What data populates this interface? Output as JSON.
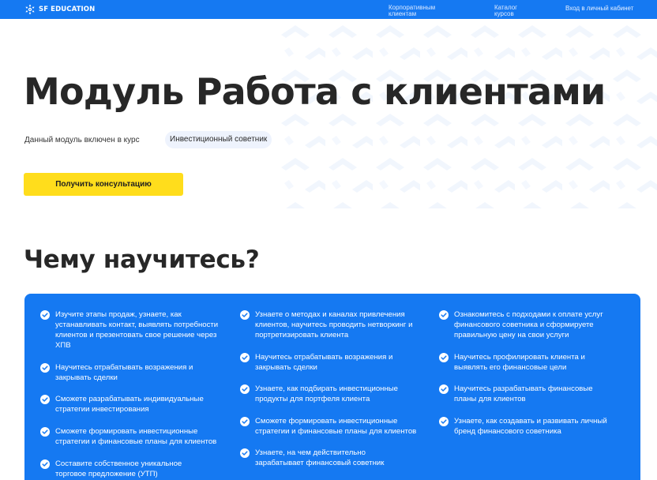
{
  "header": {
    "logo_text": "SF EDUCATION",
    "nav": {
      "corporate": "Корпоративным клиентам",
      "catalog": "Каталог курсов",
      "login": "Вход в личный кабинет"
    }
  },
  "hero": {
    "title": "Модуль Работа с клиентами",
    "included_text": "Данный модуль включен в курс",
    "course_name": "Инвестиционный советник",
    "cta_label": "Получить консультацию"
  },
  "learn": {
    "title": "Чему научитесь?",
    "columns": [
      [
        "Изучите этапы продаж, узнаете, как устанавливать контакт, выявлять потребности клиентов и презентовать свое решение через ХПВ",
        "Научитесь отрабатывать возражения и закрывать сделки",
        "Сможете разрабатывать индивидуальные стратегии инвестирования",
        "Сможете формировать инвестиционные стратегии и финансовые планы для клиентов",
        "Составите собственное уникальное торговое предложение (УТП)"
      ],
      [
        "Узнаете о методах и каналах привлечения клиентов, научитесь проводить нетворкинг и портретизировать клиента",
        "Научитесь отрабатывать возражения и закрывать сделки",
        "Узнаете, как подбирать инвестиционные продукты для портфеля клиента",
        "Сможете формировать инвестиционные стратегии и финансовые планы для клиентов",
        "Узнаете, на чем действительно зарабатывает финансовый советник"
      ],
      [
        "Ознакомитесь с подходами к оплате услуг финансового советника и сформируете правильную цену на свои услуги",
        "Научитесь профилировать клиента и выявлять его финансовые цели",
        "Научитесь разрабатывать финансовые планы для клиентов",
        "Узнаете, как создавать и развивать личный бренд финансового советника"
      ]
    ]
  },
  "colors": {
    "brand_blue": "#1579f2",
    "cta_yellow": "#ffdd1c",
    "chip_bg": "#eef3fd",
    "text_dark": "#272727"
  },
  "icons": {
    "logo": "sf-snowflake-logo-icon",
    "bullet": "check-circle-icon",
    "background": "arrow-pattern-decoration"
  }
}
